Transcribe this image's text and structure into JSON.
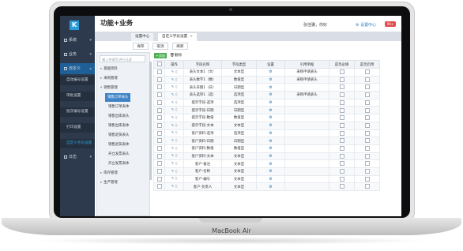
{
  "app": {
    "title": "功能+业务",
    "user": "张佳骥，你好",
    "settings_label": "设置中心",
    "notification_badge": "99+",
    "logo_text": "K",
    "brand": "MacBook Air"
  },
  "sidebar": {
    "items": [
      {
        "label": "系统",
        "icon": "system-icon"
      },
      {
        "label": "业务",
        "icon": "business-icon"
      },
      {
        "label": "自定义",
        "icon": "custom-icon"
      },
      {
        "label": "日志",
        "icon": "log-icon"
      }
    ],
    "subitems": [
      "自动编号设置",
      "审批设置",
      "批次编号设置",
      "打印设置",
      "自定义字段设置"
    ],
    "active_subitem": 4
  },
  "tabs": [
    {
      "label": "设置中心"
    },
    {
      "label": "自定义字段设置"
    }
  ],
  "toolbar": {
    "save": "保存",
    "cancel": "取消",
    "refresh": "刷新"
  },
  "tree": {
    "search_placeholder": "输入关键字进行过滤",
    "items": [
      {
        "label": "基础资料",
        "level": 0
      },
      {
        "label": "采购管理",
        "level": 0
      },
      {
        "label": "销售管理",
        "level": 0
      },
      {
        "label": "销售订单表头",
        "level": 1,
        "selected": true
      },
      {
        "label": "销售订单表体",
        "level": 1
      },
      {
        "label": "销售出库表头",
        "level": 1
      },
      {
        "label": "销售出库表体",
        "level": 1
      },
      {
        "label": "销售退货表头",
        "level": 1
      },
      {
        "label": "销售退货表体",
        "level": 1
      },
      {
        "label": "开立发票表头",
        "level": 1
      },
      {
        "label": "开立发票表体",
        "level": 1
      },
      {
        "label": "库存管理",
        "level": 0
      },
      {
        "label": "生产管理",
        "level": 0
      }
    ]
  },
  "grid": {
    "add_label": "添加",
    "delete_label": "删除",
    "headers": [
      "操作",
      "字段名称",
      "字段类型",
      "设置",
      "引用单据",
      "是否必填",
      "是否启用"
    ],
    "rows": [
      {
        "name": "表头文本1（文）",
        "type": "文本型",
        "ref": "采购申请表头"
      },
      {
        "name": "表头数字1（数）",
        "type": "数值型",
        "ref": "采购申请表头"
      },
      {
        "name": "表头日期1（日）",
        "type": "日期型",
        "ref": ""
      },
      {
        "name": "表头选项1（选）",
        "type": "选项型",
        "ref": "采购申请表头"
      },
      {
        "name": "提示字段-选项",
        "type": "选项型",
        "ref": ""
      },
      {
        "name": "提示字段-日期",
        "type": "日期型",
        "ref": ""
      },
      {
        "name": "提示字段-数值",
        "type": "数值型",
        "ref": ""
      },
      {
        "name": "提示字段-文本",
        "type": "文本型",
        "ref": ""
      },
      {
        "name": "客户资料-选项",
        "type": "选项型",
        "ref": ""
      },
      {
        "name": "客户资料-日期",
        "type": "日期型",
        "ref": ""
      },
      {
        "name": "客户资料-数值",
        "type": "数值型",
        "ref": ""
      },
      {
        "name": "客户资料-文本",
        "type": "文本型",
        "ref": ""
      },
      {
        "name": "客户-备注",
        "type": "文本型",
        "ref": ""
      },
      {
        "name": "客户-名称",
        "type": "文本型",
        "ref": ""
      },
      {
        "name": "客户-编号",
        "type": "文本型",
        "ref": ""
      },
      {
        "name": "客户-负责人",
        "type": "文本型",
        "ref": ""
      }
    ]
  }
}
